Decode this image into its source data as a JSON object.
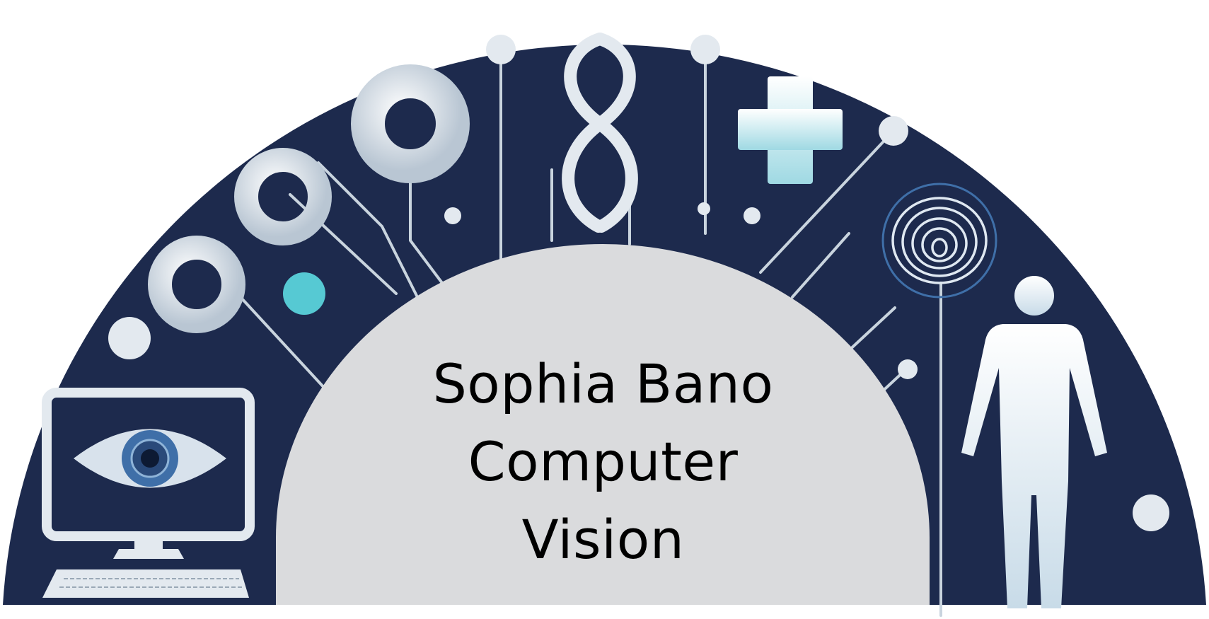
{
  "logo": {
    "title_lines": [
      "Sophia Bano",
      "Computer",
      "Vision"
    ]
  },
  "colors": {
    "background": "#ffffff",
    "arc_navy": "#1d2a4d",
    "center_dome": "#dadbdd",
    "icon_light": "#e3e9ef",
    "accent_teal": "#56c9d3",
    "accent_blue": "#3f6fa8",
    "text": "#000000"
  },
  "icons": [
    "monitor-eye-icon",
    "keyboard-icon",
    "ring-icon",
    "teal-dot-icon",
    "dna-helix-icon",
    "plus-icon",
    "fingerprint-icon",
    "human-figure-icon"
  ]
}
